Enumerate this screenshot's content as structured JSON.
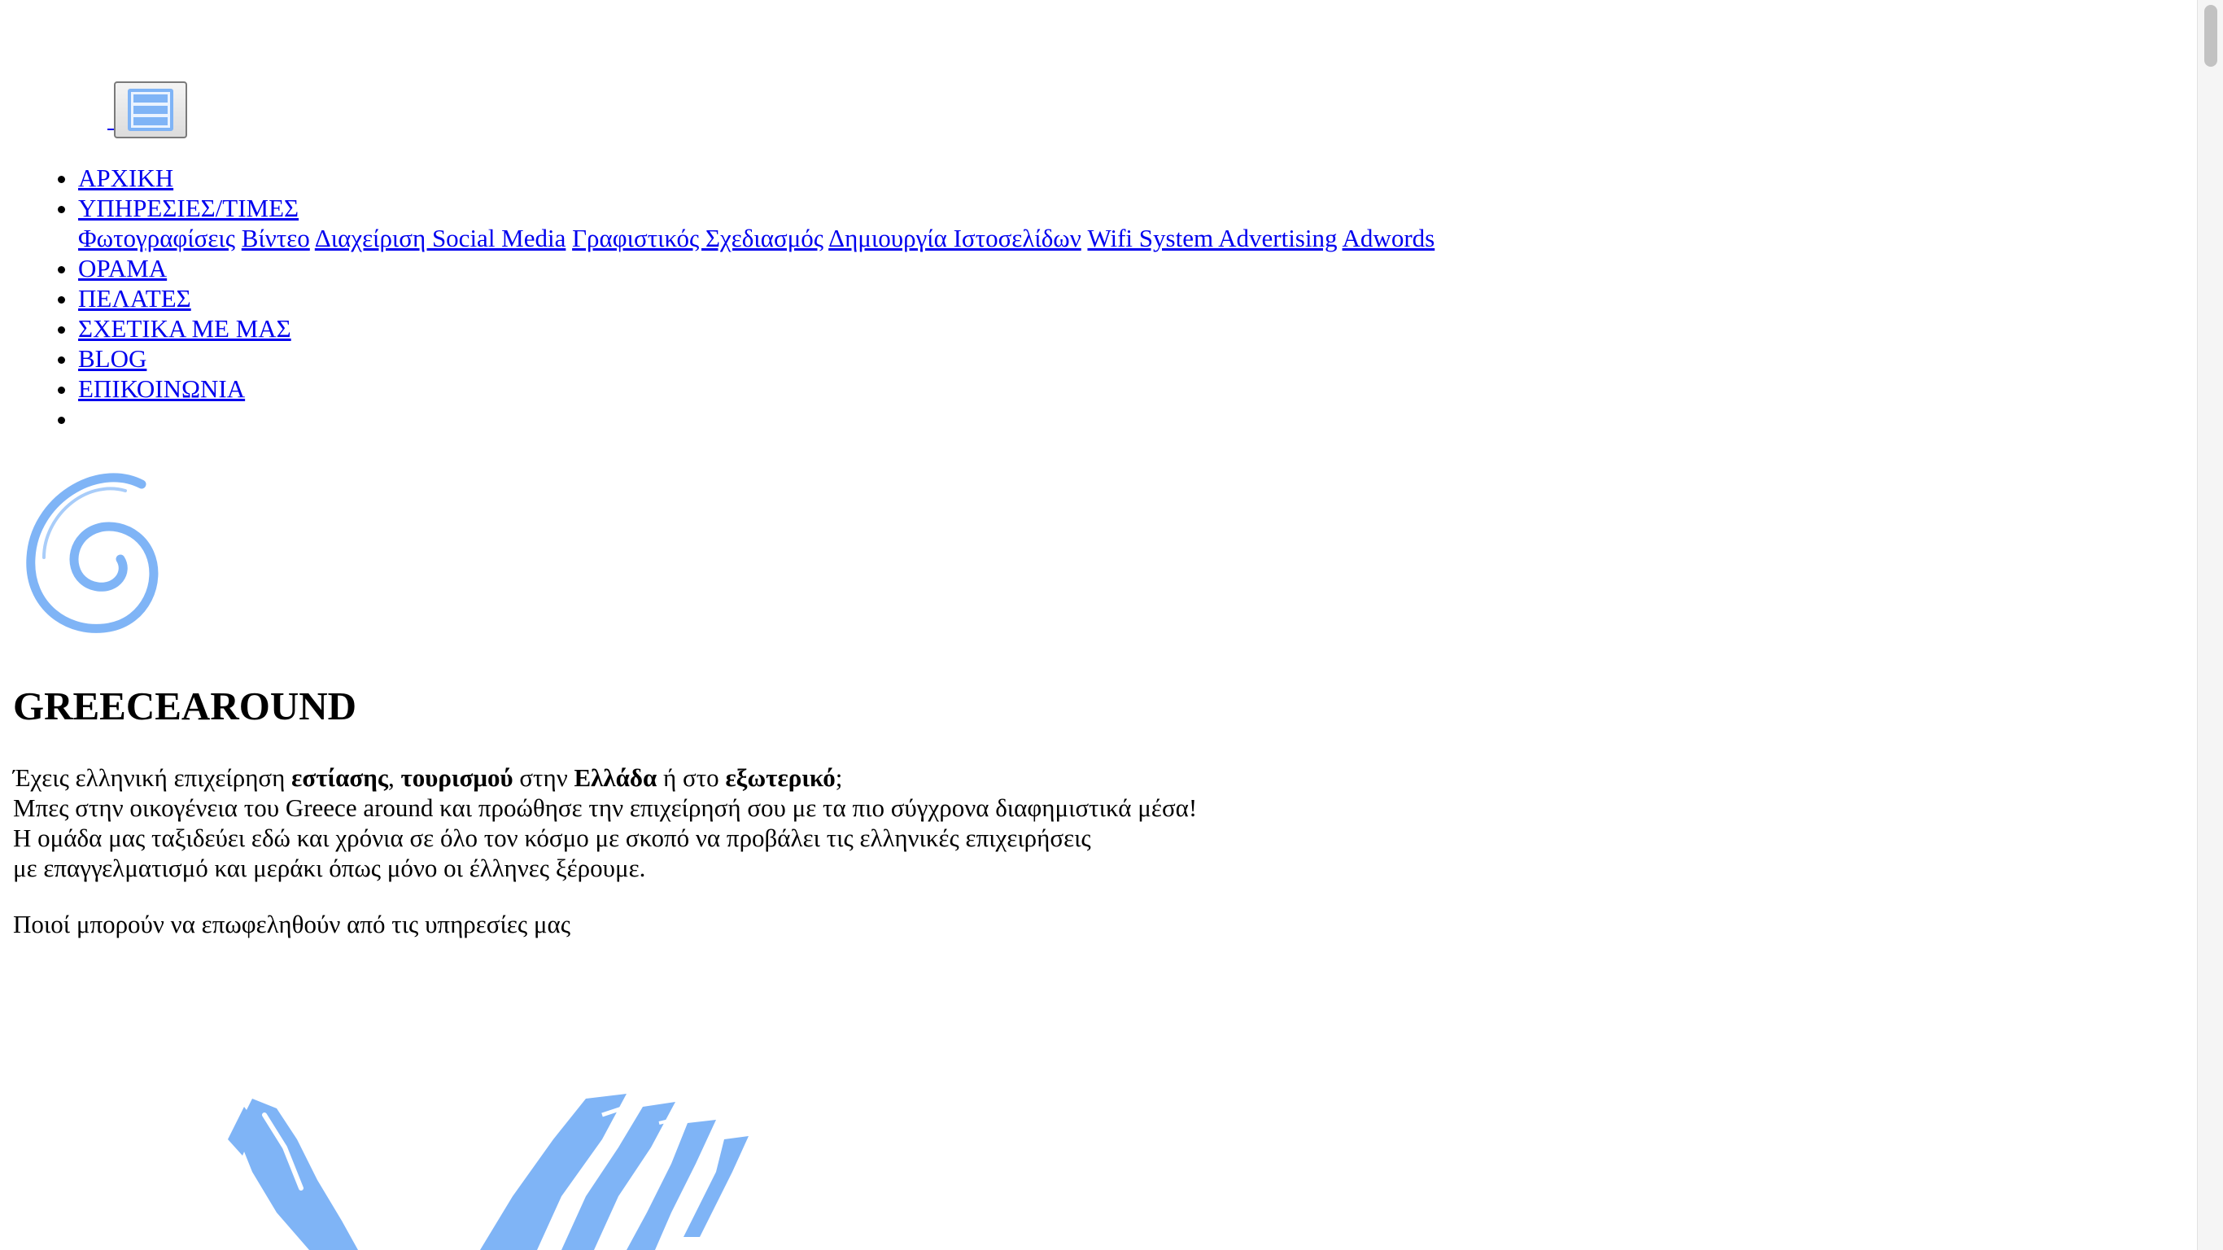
{
  "menu_toggle": {
    "icon": "hamburger-icon"
  },
  "nav": {
    "items": [
      {
        "label": "ΑΡΧΙΚΗ"
      },
      {
        "label": "ΥΠΗΡΕΣΙΕΣ/ΤΙΜΕΣ"
      },
      {
        "label": "ΟΡΑΜΑ"
      },
      {
        "label": "ΠΕΛΑΤΕΣ"
      },
      {
        "label": "ΣΧΕΤΙΚΑ ΜΕ ΜΑΣ"
      },
      {
        "label": "BLOG"
      },
      {
        "label": "ΕΠΙΚΟΙΝΩΝΙΑ"
      }
    ],
    "submenu": [
      "Φωτογραφίσεις",
      "Βίντεο",
      "Διαχείριση Social Media",
      "Γραφιστικός Σχεδιασμός",
      "Δημιουργία Ιστοσελίδων",
      "Wifi System Advertising",
      "Adwords"
    ]
  },
  "logo": {
    "icon": "spiral-logo-icon",
    "color": "#7fb4f6"
  },
  "site_title": "GREECEAROUND",
  "intro": {
    "line1": {
      "p1": "Έχεις ελληνική επιχείρηση ",
      "b1": "εστίασης",
      "p2": ", ",
      "b2": "τουρισμού",
      "p3": " στην ",
      "b3": "Ελλάδα",
      "p4": " ή στο ",
      "b4": "εξωτερικό",
      "p5": ";"
    },
    "line2": "Μπες στην οικογένεια του Greece around και προώθησε την επιχείρησή σου με τα πιο σύγχρονα διαφημιστικά μέσα!",
    "line3": "Η ομάδα μας ταξιδεύει εδώ και χρόνια σε όλο τον κόσμο με σκοπό να προβάλει τις ελληνικές επιχειρήσεις",
    "line4": "με επαγγελματισμό και μεράκι όπως μόνο οι έλληνες ξέρουμε."
  },
  "who_benefits": "Ποιοί μπορούν να επωφεληθούν από τις υπηρεσίες μας",
  "graphic": {
    "icon": "brush-stroke-graphic",
    "color": "#7fb4f6"
  },
  "colors": {
    "link": "#0000ee",
    "accent": "#7fb4f6",
    "text": "#000000",
    "background": "#ffffff"
  }
}
